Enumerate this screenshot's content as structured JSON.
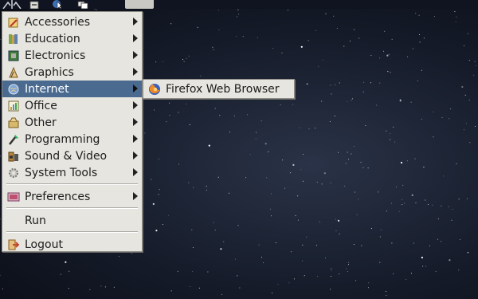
{
  "menu": {
    "items": [
      {
        "label": "Accessories",
        "icon": "accessories-icon",
        "has_submenu": true
      },
      {
        "label": "Education",
        "icon": "education-icon",
        "has_submenu": true
      },
      {
        "label": "Electronics",
        "icon": "electronics-icon",
        "has_submenu": true
      },
      {
        "label": "Graphics",
        "icon": "graphics-icon",
        "has_submenu": true
      },
      {
        "label": "Internet",
        "icon": "internet-icon",
        "has_submenu": true,
        "highlighted": true
      },
      {
        "label": "Office",
        "icon": "office-icon",
        "has_submenu": true
      },
      {
        "label": "Other",
        "icon": "other-icon",
        "has_submenu": true
      },
      {
        "label": "Programming",
        "icon": "programming-icon",
        "has_submenu": true
      },
      {
        "label": "Sound & Video",
        "icon": "sound-video-icon",
        "has_submenu": true
      },
      {
        "label": "System Tools",
        "icon": "system-tools-icon",
        "has_submenu": true
      }
    ],
    "preferences": {
      "label": "Preferences",
      "icon": "preferences-icon"
    },
    "run": {
      "label": "Run"
    },
    "logout": {
      "label": "Logout",
      "icon": "logout-icon"
    }
  },
  "submenu": {
    "items": [
      {
        "label": "Firefox Web Browser",
        "icon": "firefox-icon"
      }
    ]
  },
  "colors": {
    "menu_bg": "#e6e5df",
    "highlight": "#4a6a8f",
    "desktop_bg": "#151b29"
  }
}
